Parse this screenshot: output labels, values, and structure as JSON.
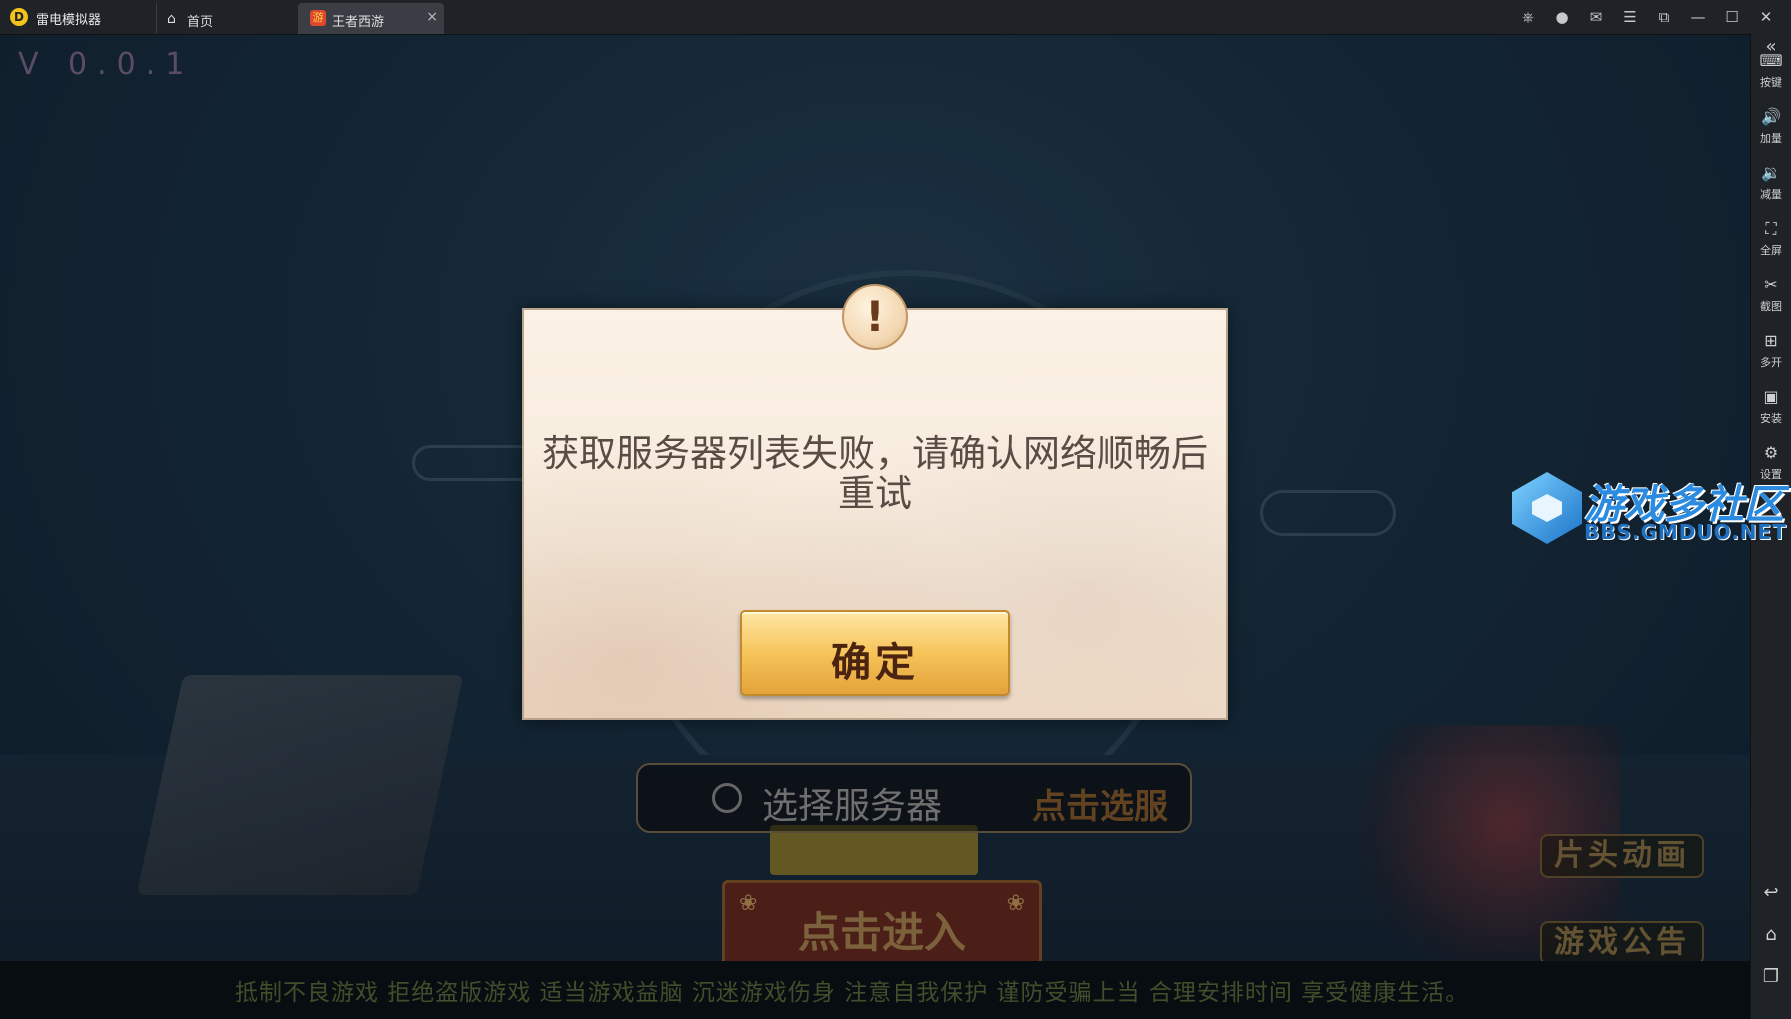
{
  "titlebar": {
    "app_name": "雷电模拟器",
    "logo_glyph": "D",
    "tabs": [
      {
        "label": "首页",
        "icon": "home-icon",
        "glyph": "⌂"
      },
      {
        "label": "王者西游",
        "icon": "game-app-icon",
        "glyph": "游",
        "close_glyph": "×"
      }
    ],
    "window_controls": [
      {
        "name": "gamepad-icon",
        "glyph": "⎈"
      },
      {
        "name": "user-icon",
        "glyph": "●"
      },
      {
        "name": "mail-icon",
        "glyph": "✉"
      },
      {
        "name": "menu-icon",
        "glyph": "☰"
      },
      {
        "name": "pip-icon",
        "glyph": "⧉"
      },
      {
        "name": "minimize-icon",
        "glyph": "—"
      },
      {
        "name": "maximize-icon",
        "glyph": "☐"
      },
      {
        "name": "close-icon",
        "glyph": "✕"
      }
    ]
  },
  "toolbar": {
    "collapse_glyph": "«",
    "items": [
      {
        "label": "按键",
        "icon": "keyboard-icon",
        "glyph": "⌨"
      },
      {
        "label": "加量",
        "icon": "volume-up-icon",
        "glyph": "🔊"
      },
      {
        "label": "减量",
        "icon": "volume-down-icon",
        "glyph": "🔉"
      },
      {
        "label": "全屏",
        "icon": "fullscreen-icon",
        "glyph": "⛶"
      },
      {
        "label": "截图",
        "icon": "scissors-icon",
        "glyph": "✂"
      },
      {
        "label": "多开",
        "icon": "multi-instance-icon",
        "glyph": "⊞"
      },
      {
        "label": "安装",
        "icon": "apk-install-icon",
        "glyph": "▣"
      },
      {
        "label": "设置",
        "icon": "settings-icon",
        "glyph": "⚙"
      }
    ],
    "nav": [
      {
        "name": "back-icon",
        "glyph": "↩"
      },
      {
        "name": "home-nav-icon",
        "glyph": "⌂"
      },
      {
        "name": "recent-apps-icon",
        "glyph": "❐"
      }
    ]
  },
  "game": {
    "version": "V 0.0.1",
    "server_select": {
      "label": "选择服务器",
      "action": "点击选服"
    },
    "enter_button": "点击进入",
    "flower_glyph": "❀",
    "side_buttons": {
      "intro_animation": "片头动画",
      "announcement": "游戏公告"
    },
    "footer": "抵制不良游戏  拒绝盗版游戏  适当游戏益脑  沉迷游戏伤身  注意自我保护  谨防受骗上当  合理安排时间  享受健康生活。"
  },
  "dialog": {
    "badge_glyph": "!",
    "message": "获取服务器列表失败，请确认网络顺畅后重试",
    "confirm_label": "确定"
  },
  "watermark": {
    "title": "游戏多社区",
    "url": "BBS.GMDUO.NET"
  },
  "colors": {
    "dialog_bg": "#f6ebdd",
    "confirm_gold": "#f6c45a",
    "titlebar": "#1f2226",
    "game_bg": "#1b3448"
  }
}
